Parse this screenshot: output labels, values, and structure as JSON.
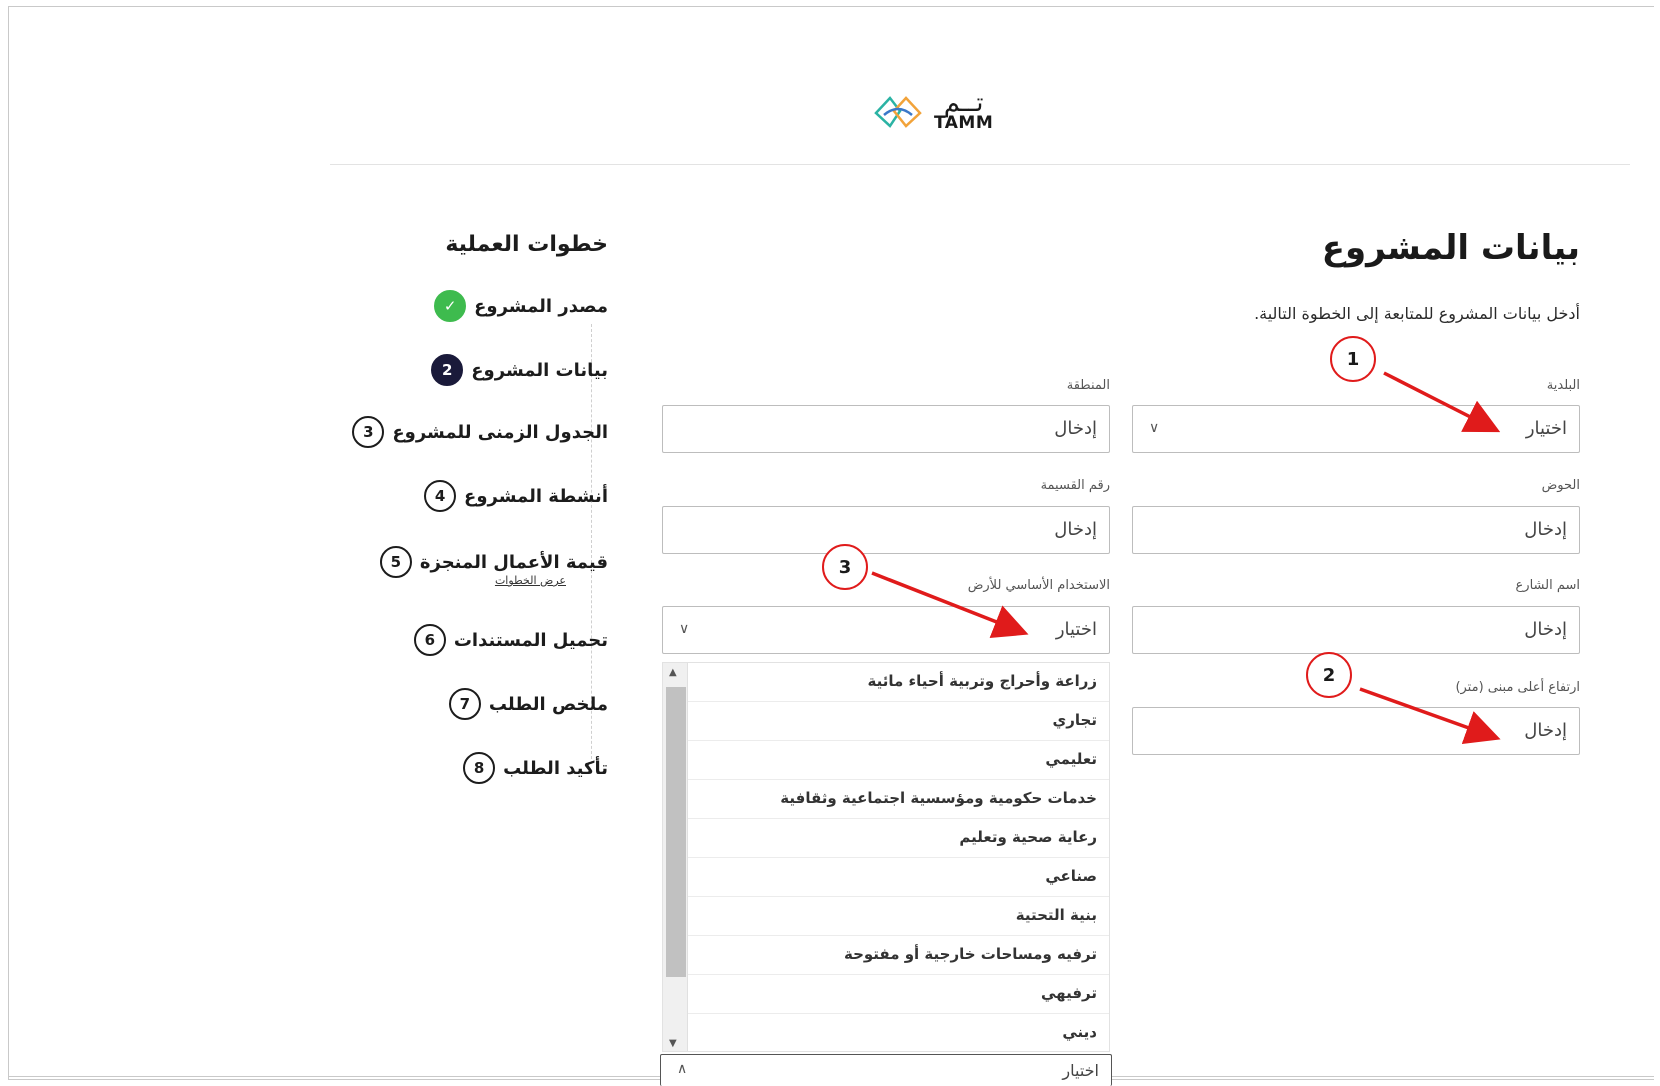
{
  "logo": {
    "arabic": "تــم",
    "english": "TAMM"
  },
  "steps": {
    "title": "خطوات العملية",
    "items": [
      {
        "num": "",
        "label": "مصدر المشروع",
        "state": "done"
      },
      {
        "num": "2",
        "label": "بيانات المشروع",
        "state": "active"
      },
      {
        "num": "3",
        "label": "الجدول الزمنى للمشروع",
        "state": "pending"
      },
      {
        "num": "4",
        "label": "أنشطة المشروع",
        "state": "pending"
      },
      {
        "num": "5",
        "label": "قيمة الأعمال المنجزة",
        "state": "pending"
      },
      {
        "num": "6",
        "label": "تحميل المستندات",
        "state": "pending"
      },
      {
        "num": "7",
        "label": "ملخص الطلب",
        "state": "pending"
      },
      {
        "num": "8",
        "label": "تأكيد الطلب",
        "state": "pending"
      }
    ],
    "view_steps_link": "عرض الخطوات"
  },
  "form": {
    "title": "بيانات المشروع",
    "subtitle": "أدخل بيانات المشروع للمتابعة إلى الخطوة التالية.",
    "municipality": {
      "label": "البلدية",
      "value": "اختيار"
    },
    "region": {
      "label": "المنطقة",
      "value": "إدخال"
    },
    "basin": {
      "label": "الحوض",
      "value": "إدخال"
    },
    "plot_number": {
      "label": "رقم القسيمة",
      "value": "إدخال"
    },
    "street_name": {
      "label": "اسم الشارع",
      "value": "إدخال"
    },
    "land_use": {
      "label": "الاستخدام الأساسي للأرض",
      "value": "اختيار"
    },
    "building_height": {
      "label": "ارتفاع أعلى مبنى (متر)",
      "value": "إدخال"
    },
    "bottom_select": {
      "value": "اختيار"
    }
  },
  "land_use_options": [
    "زراعة وأحراج وتربية أحياء مائية",
    "تجاري",
    "تعليمي",
    "خدمات حكومية ومؤسسية اجتماعية وثقافية",
    "رعاية صحية وتعليم",
    "صناعي",
    "بنية التحتية",
    "ترفيه ومساحات خارجية أو مفتوحة",
    "ترفيهي",
    "ديني"
  ],
  "annotations": [
    "1",
    "2",
    "3"
  ],
  "colors": {
    "accent_red": "#e01b1b",
    "done_green": "#3ebb4e",
    "active_navy": "#1a1a3a"
  }
}
